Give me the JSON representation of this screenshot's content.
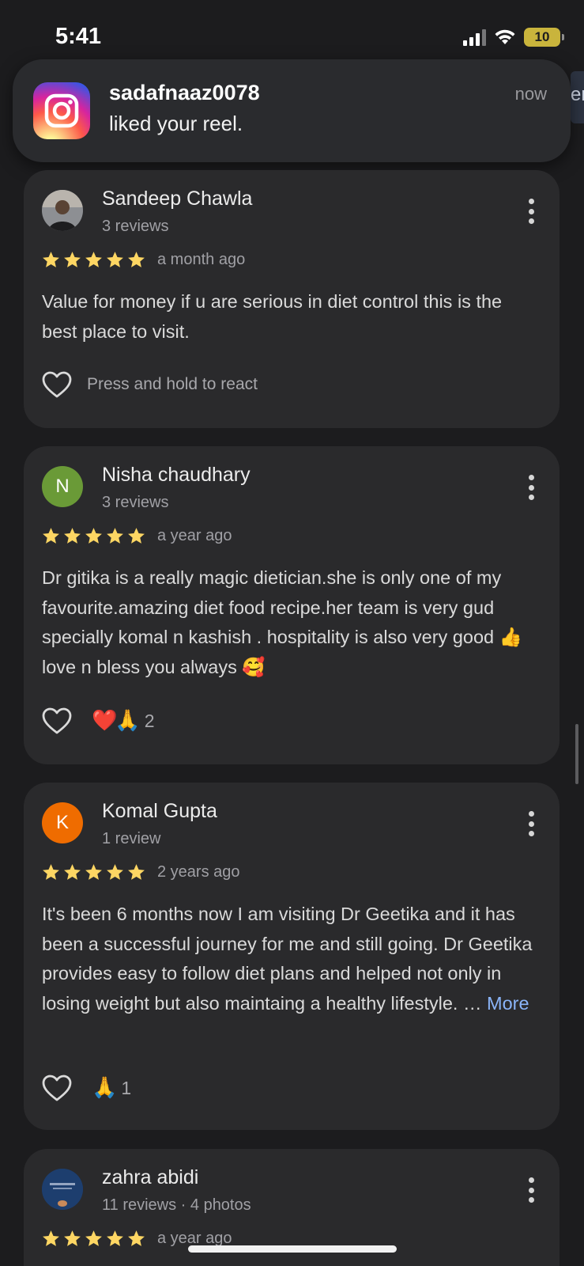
{
  "status_bar": {
    "time": "5:41",
    "battery": "10"
  },
  "notification": {
    "app_icon": "instagram-icon",
    "user": "sadafnaaz0078",
    "message": "liked your reel.",
    "time": "now",
    "edge_peek": "er"
  },
  "reviews": [
    {
      "name": "Sandeep Chawla",
      "meta": "3 reviews",
      "avatar_type": "photo",
      "stars": 5,
      "time": "a month ago",
      "text": "Value for money if u are serious in diet control this is the best place to visit.",
      "react_hint": "Press and hold to react"
    },
    {
      "name": "Nisha chaudhary",
      "meta": "3 reviews",
      "avatar_letter": "N",
      "avatar_color": "#6a9a37",
      "stars": 5,
      "time": "a year ago",
      "text": "Dr gitika is a really magic dietician.she is only one of my favourite.amazing diet food recipe.her team is very gud specially komal n kashish . hospitality is also very good 👍 love n bless you always 🥰",
      "reactions_emoji": "❤️🙏",
      "reactions_count": "2"
    },
    {
      "name": "Komal Gupta",
      "meta": "1 review",
      "avatar_letter": "K",
      "avatar_color": "#ef6c00",
      "stars": 5,
      "time": "2 years ago",
      "text": "It's been 6 months now I am visiting Dr Geetika and it has been a successful journey for me and still going. Dr Geetika provides easy to follow diet plans and helped not only in losing weight but also maintaing a healthy lifestyle. … ",
      "more_label": "More",
      "reactions_emoji": "🙏",
      "reactions_count": "1"
    },
    {
      "name": "zahra abidi",
      "meta": "11 reviews · 4 photos",
      "avatar_type": "photo",
      "stars": 5,
      "time": "a year ago"
    }
  ],
  "colors": {
    "background": "#1c1c1e",
    "card": "#2a2a2c",
    "star": "#fdd663",
    "link": "#8ab4f8"
  }
}
